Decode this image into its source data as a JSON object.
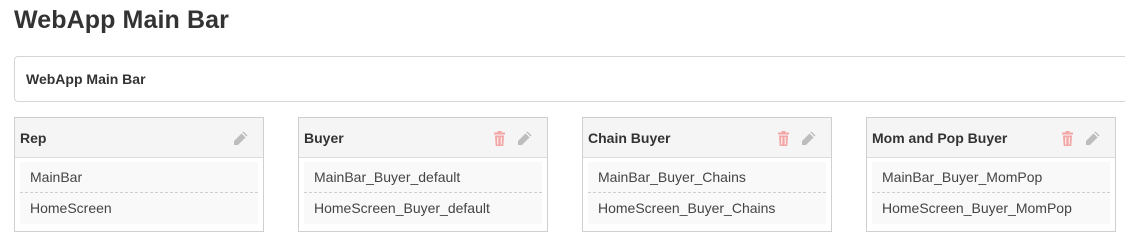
{
  "page": {
    "title": "WebApp Main Bar"
  },
  "name_field": {
    "value": "WebApp Main Bar"
  },
  "cards": [
    {
      "title": "Rep",
      "items": [
        "MainBar",
        "HomeScreen"
      ],
      "deletable": false
    },
    {
      "title": "Buyer",
      "items": [
        "MainBar_Buyer_default",
        "HomeScreen_Buyer_default"
      ],
      "deletable": true
    },
    {
      "title": "Chain Buyer",
      "items": [
        "MainBar_Buyer_Chains",
        "HomeScreen_Buyer_Chains"
      ],
      "deletable": true
    },
    {
      "title": "Mom and Pop Buyer",
      "items": [
        "MainBar_Buyer_MomPop",
        "HomeScreen_Buyer_MomPop"
      ],
      "deletable": true
    }
  ],
  "colors": {
    "delete_icon": "#f2a6a6",
    "edit_icon": "#bdbdbd"
  },
  "icons": {
    "delete": "trash-icon",
    "edit": "pencil-icon"
  }
}
